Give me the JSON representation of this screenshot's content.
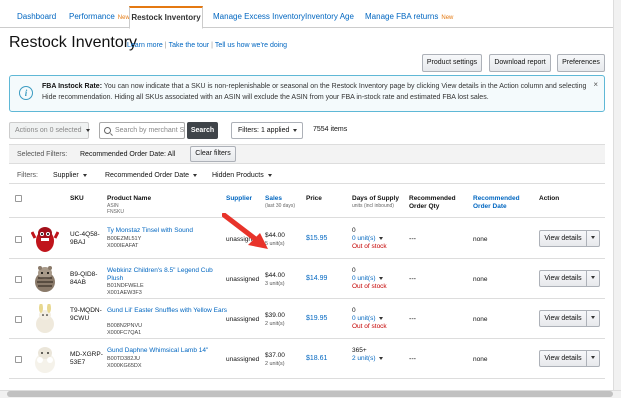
{
  "tabs": [
    {
      "label": "Dashboard",
      "new": ""
    },
    {
      "label": "Performance",
      "new": "New"
    },
    {
      "label": "Restock Inventory",
      "new": ""
    },
    {
      "label": "Manage Excess Inventory",
      "new": ""
    },
    {
      "label": "Inventory Age",
      "new": ""
    },
    {
      "label": "Manage FBA returns",
      "new": "New"
    }
  ],
  "header": {
    "title": "Restock Inventory",
    "links": [
      "Learn more",
      "Take the tour",
      "Tell us how we're doing"
    ],
    "buttons": [
      "Product settings",
      "Download report",
      "Preferences"
    ]
  },
  "info": {
    "bold": "FBA Instock Rate:",
    "text": "You can now indicate that a SKU is non-replenishable or seasonal on the Restock Inventory page by clicking View details in the Action column and selecting Hide recommendation. Hiding all SKUs associated with an ASIN will exclude the ASIN from your FBA in-stock rate and estimated FBA lost sales.",
    "close": "×"
  },
  "toolbar": {
    "actions": "Actions on 0 selected",
    "search_placeholder": "Search by merchant S",
    "search_button": "Search",
    "filters_applied": "Filters: 1 applied",
    "items_count": "7554 items"
  },
  "selected_filters": {
    "label": "Selected Filters:",
    "value": "Recommended Order Date: All",
    "clear": "Clear filters"
  },
  "filter_bar": {
    "label": "Filters:",
    "supplier": "Supplier",
    "order_date": "Recommended Order Date",
    "hidden": "Hidden Products"
  },
  "columns": {
    "sku": "SKU",
    "product": "Product Name",
    "product_sub1": "ASIN",
    "product_sub2": "FNSKU",
    "supplier": "Supplier",
    "sales": "Sales",
    "sales_sub": "(last 30 days)",
    "price": "Price",
    "dos": "Days of Supply",
    "dos_sub": "units (incl inbound)",
    "rec_qty": "Recommended Order Qty",
    "rec_date": "Recommended Order Date",
    "action": "Action"
  },
  "rows": [
    {
      "sku": "UC-4Q58-9BAJ",
      "name": "Ty Monstaz Tinsel with Sound",
      "asin": "B00EZML51Y",
      "fnsku": "X000IEAFAT",
      "supplier": "unassigned",
      "sales": "$44.00",
      "units": "5 unit(s)",
      "price": "$15.95",
      "dos": "0",
      "dos_units": "0 unit(s)",
      "dos_status": "Out of stock",
      "rec_qty": "---",
      "rec_date": "none",
      "action": "View details",
      "icon": "red-monster-toy-thumbnail"
    },
    {
      "sku": "B9-QID8-84AB",
      "name": "Webkinz Children's 8.5\" Legend Cub Plush",
      "asin": "B01NDFWELE",
      "fnsku": "X001AEW3F3",
      "supplier": "unassigned",
      "sales": "$44.00",
      "units": "3 unit(s)",
      "price": "$14.99",
      "dos": "0",
      "dos_units": "0 unit(s)",
      "dos_status": "Out of stock",
      "rec_qty": "---",
      "rec_date": "none",
      "action": "View details",
      "icon": "tiger-cub-plush-thumbnail"
    },
    {
      "sku": "T9-MQDN-9CWU",
      "name": "Gund Lil' Easter Snuffles with Yellow Ears",
      "asin": "B008N2PNVU",
      "fnsku": "X000FC7QA1",
      "supplier": "unassigned",
      "sales": "$39.00",
      "units": "2 unit(s)",
      "price": "$19.95",
      "dos": "0",
      "dos_units": "0 unit(s)",
      "dos_status": "Out of stock",
      "rec_qty": "---",
      "rec_date": "none",
      "action": "View details",
      "icon": "bunny-plush-thumbnail"
    },
    {
      "sku": "MD-XGRP-53E7",
      "name": "Gund Daphne Whimsical Lamb 14\"",
      "asin": "B00TD382JU",
      "fnsku": "X000KG65DX",
      "supplier": "unassigned",
      "sales": "$37.00",
      "units": "2 unit(s)",
      "price": "$18.61",
      "dos": "365+",
      "dos_units": "2 unit(s)",
      "dos_status": "",
      "rec_qty": "---",
      "rec_date": "none",
      "action": "View details",
      "icon": "lamb-plush-thumbnail"
    }
  ]
}
